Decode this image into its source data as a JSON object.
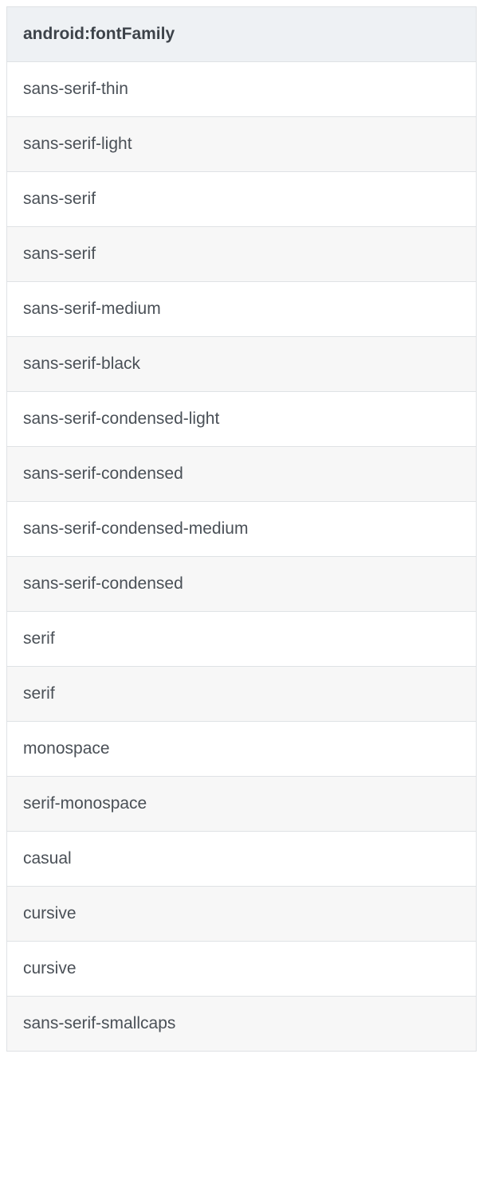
{
  "table": {
    "header": "android:fontFamily",
    "rows": [
      "sans-serif-thin",
      "sans-serif-light",
      "sans-serif",
      "sans-serif",
      "sans-serif-medium",
      "sans-serif-black",
      "sans-serif-condensed-light",
      "sans-serif-condensed",
      "sans-serif-condensed-medium",
      "sans-serif-condensed",
      "serif",
      "serif",
      "monospace",
      "serif-monospace",
      "casual",
      "cursive",
      "cursive",
      "sans-serif-smallcaps"
    ]
  }
}
